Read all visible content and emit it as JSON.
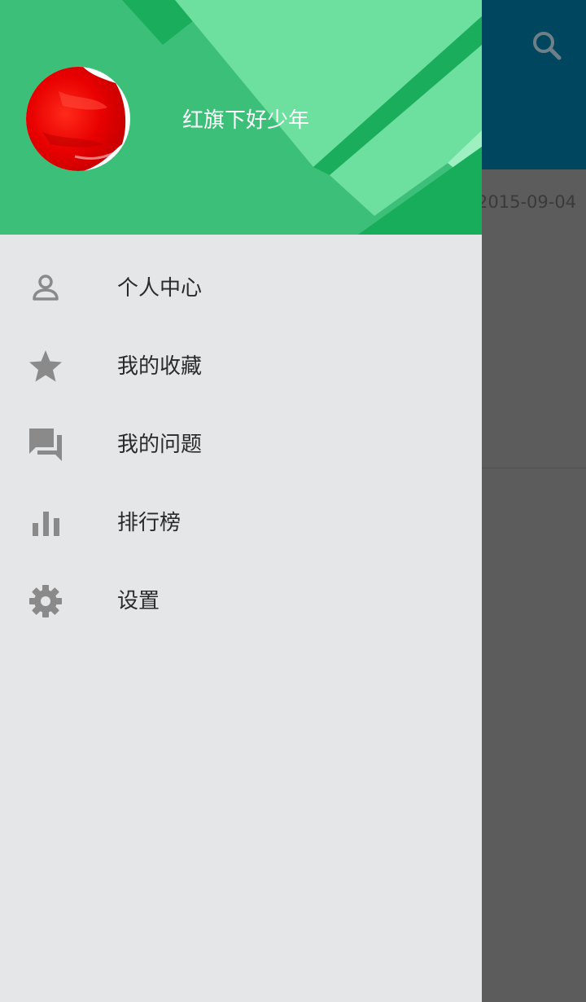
{
  "background_app": {
    "date_text": "2015-09-04",
    "toolbar_color": "#00465f"
  },
  "drawer": {
    "header": {
      "user_name": "红旗下好少年",
      "accent_colors": [
        "#3cbf78",
        "#1aad5c",
        "#6ddf9f",
        "#9ef0c0"
      ]
    },
    "menu": [
      {
        "icon": "person-icon",
        "label": "个人中心"
      },
      {
        "icon": "star-icon",
        "label": "我的收藏"
      },
      {
        "icon": "forum-icon",
        "label": "我的问题"
      },
      {
        "icon": "bar-chart-icon",
        "label": "排行榜"
      },
      {
        "icon": "gear-icon",
        "label": "设置"
      }
    ]
  }
}
